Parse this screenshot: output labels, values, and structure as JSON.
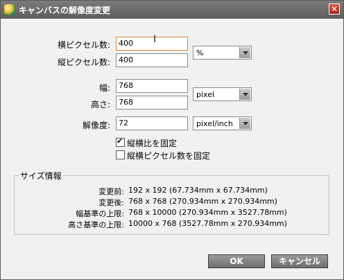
{
  "window": {
    "title": "キャンバスの解像度変更",
    "close_glyph": "✕"
  },
  "fields": {
    "width_px": {
      "label": "横ピクセル数:",
      "value": "400"
    },
    "height_px": {
      "label": "縦ピクセル数:",
      "value": "400"
    },
    "unit1": {
      "value": "%"
    },
    "width": {
      "label": "幅:",
      "value": "768"
    },
    "height": {
      "label": "高さ:",
      "value": "768"
    },
    "unit2": {
      "value": "pixel"
    },
    "resolution": {
      "label": "解像度:",
      "value": "72"
    },
    "res_unit": {
      "value": "pixel/inch"
    }
  },
  "options": {
    "keep_ratio": {
      "label": "縦横比を固定",
      "checked": true
    },
    "fix_pixels": {
      "label": "縦横ピクセル数を固定",
      "checked": false
    }
  },
  "size_info": {
    "title": "サイズ情報",
    "rows": [
      {
        "label": "変更前:",
        "value": "192 x 192 (67.734mm x 67.734mm)"
      },
      {
        "label": "変更後:",
        "value": "768 x 768 (270.934mm x 270.934mm)"
      },
      {
        "label": "幅基準の上限:",
        "value": "768 x 10000 (270.934mm x 3527.78mm)"
      },
      {
        "label": "高さ基準の上限:",
        "value": "10000 x 768 (3527.78mm x 270.934mm)"
      }
    ]
  },
  "buttons": {
    "ok": "OK",
    "cancel": "キャンセル"
  }
}
